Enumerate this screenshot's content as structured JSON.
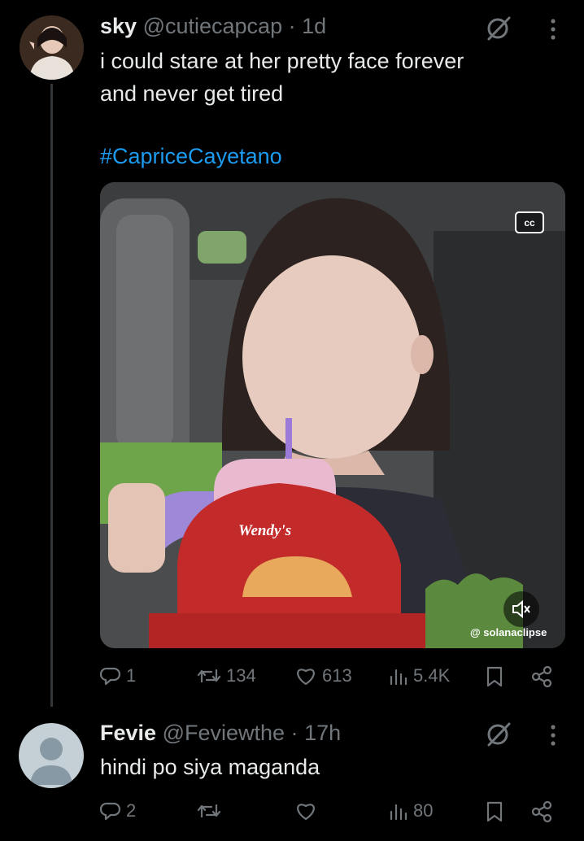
{
  "post": {
    "display_name": "sky",
    "handle": "@cutiecapcap",
    "separator": "·",
    "time": "1d",
    "text_line1": "i could stare at her pretty face forever",
    "text_line2": "and never get tired",
    "hashtag": "#CapriceCayetano",
    "media": {
      "cc_label": "cc",
      "brand_logo": "Wendy's",
      "watermark": "@ solanaclipse"
    },
    "actions": {
      "replies": "1",
      "reposts": "134",
      "likes": "613",
      "views": "5.4K"
    }
  },
  "reply": {
    "display_name": "Fevie",
    "handle": "@Feviewthe",
    "separator": "·",
    "time": "17h",
    "text": "hindi po siya maganda",
    "actions": {
      "replies": "2",
      "reposts": "",
      "likes": "",
      "views": "80"
    }
  },
  "icons": [
    "grok-icon",
    "more-icon",
    "reply-icon",
    "repost-icon",
    "like-icon",
    "views-icon",
    "bookmark-icon",
    "share-icon",
    "cc-icon",
    "mute-icon"
  ],
  "colors": {
    "background": "#000000",
    "text": "#e7e9ea",
    "secondary": "#71767b",
    "link": "#1d9bf0",
    "thread_line": "#333639"
  }
}
